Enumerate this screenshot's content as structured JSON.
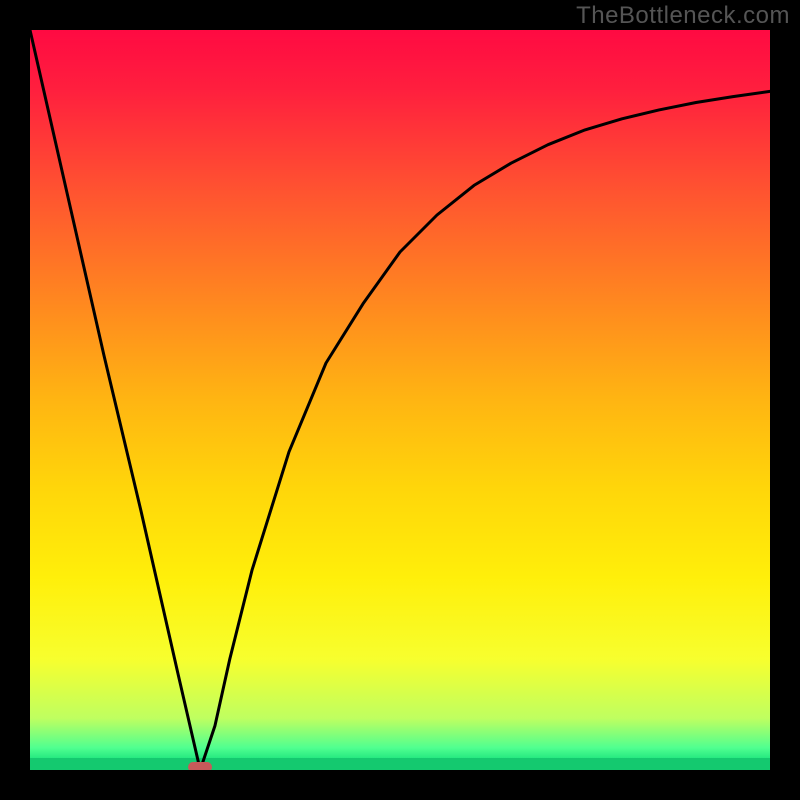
{
  "watermark": "TheBottleneck.com",
  "chart_data": {
    "type": "line",
    "title": "",
    "xlabel": "",
    "ylabel": "",
    "xlim": [
      0,
      100
    ],
    "ylim": [
      0,
      100
    ],
    "grid": false,
    "series": [
      {
        "name": "bottleneck-curve",
        "x": [
          0,
          5,
          10,
          15,
          20,
          23,
          25,
          27,
          30,
          35,
          40,
          45,
          50,
          55,
          60,
          65,
          70,
          75,
          80,
          85,
          90,
          95,
          100
        ],
        "y": [
          100,
          78,
          56,
          35,
          13,
          0,
          6,
          15,
          27,
          43,
          55,
          63,
          70,
          75,
          79,
          82,
          84.5,
          86.5,
          88,
          89.2,
          90.2,
          91,
          91.7
        ]
      }
    ],
    "annotations": [
      {
        "name": "min-marker",
        "x": 23,
        "y": 0,
        "color": "#c75a5a"
      }
    ],
    "background": "vertical-gradient red→orange→yellow→green",
    "frame_border_color": "#000000"
  },
  "colors": {
    "curve": "#000000",
    "frame": "#000000",
    "marker": "#c75a5a",
    "watermark": "#555555"
  }
}
